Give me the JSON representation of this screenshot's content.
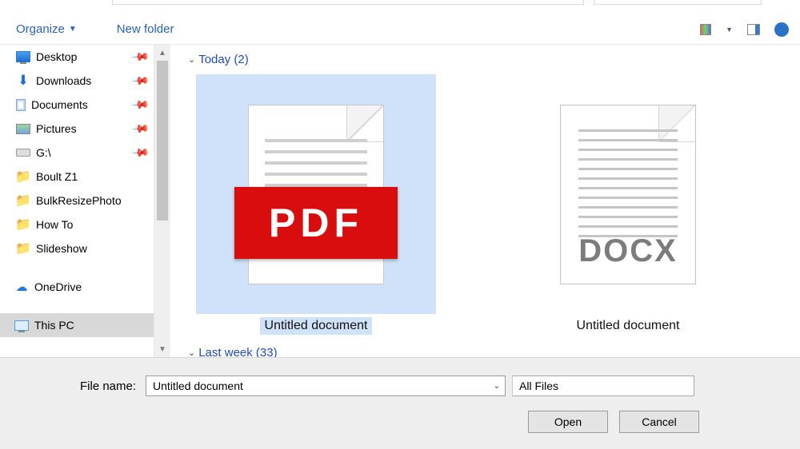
{
  "toolbar": {
    "organize_label": "Organize",
    "new_folder_label": "New folder"
  },
  "sidebar": {
    "items": [
      {
        "label": "Desktop",
        "icon": "monitor",
        "pinned": true
      },
      {
        "label": "Downloads",
        "icon": "download",
        "pinned": true
      },
      {
        "label": "Documents",
        "icon": "doc",
        "pinned": true
      },
      {
        "label": "Pictures",
        "icon": "pic",
        "pinned": true
      },
      {
        "label": "G:\\",
        "icon": "drive",
        "pinned": true
      },
      {
        "label": "Boult Z1",
        "icon": "folder",
        "pinned": false
      },
      {
        "label": "BulkResizePhoto",
        "icon": "folder",
        "pinned": false
      },
      {
        "label": "How To",
        "icon": "folder",
        "pinned": false
      },
      {
        "label": "Slideshow",
        "icon": "folder",
        "pinned": false
      }
    ],
    "onedrive_label": "OneDrive",
    "this_pc_label": "This PC"
  },
  "content": {
    "groups": [
      {
        "label": "Today (2)"
      },
      {
        "label": "Last week (33)"
      }
    ],
    "files": [
      {
        "label": "Untitled document",
        "type": "PDF",
        "selected": true
      },
      {
        "label": "Untitled document",
        "type": "DOCX",
        "selected": false
      }
    ]
  },
  "bottom": {
    "filename_label": "File name:",
    "filename_value": "Untitled document",
    "filter_value": "All Files",
    "open_label": "Open",
    "cancel_label": "Cancel"
  }
}
